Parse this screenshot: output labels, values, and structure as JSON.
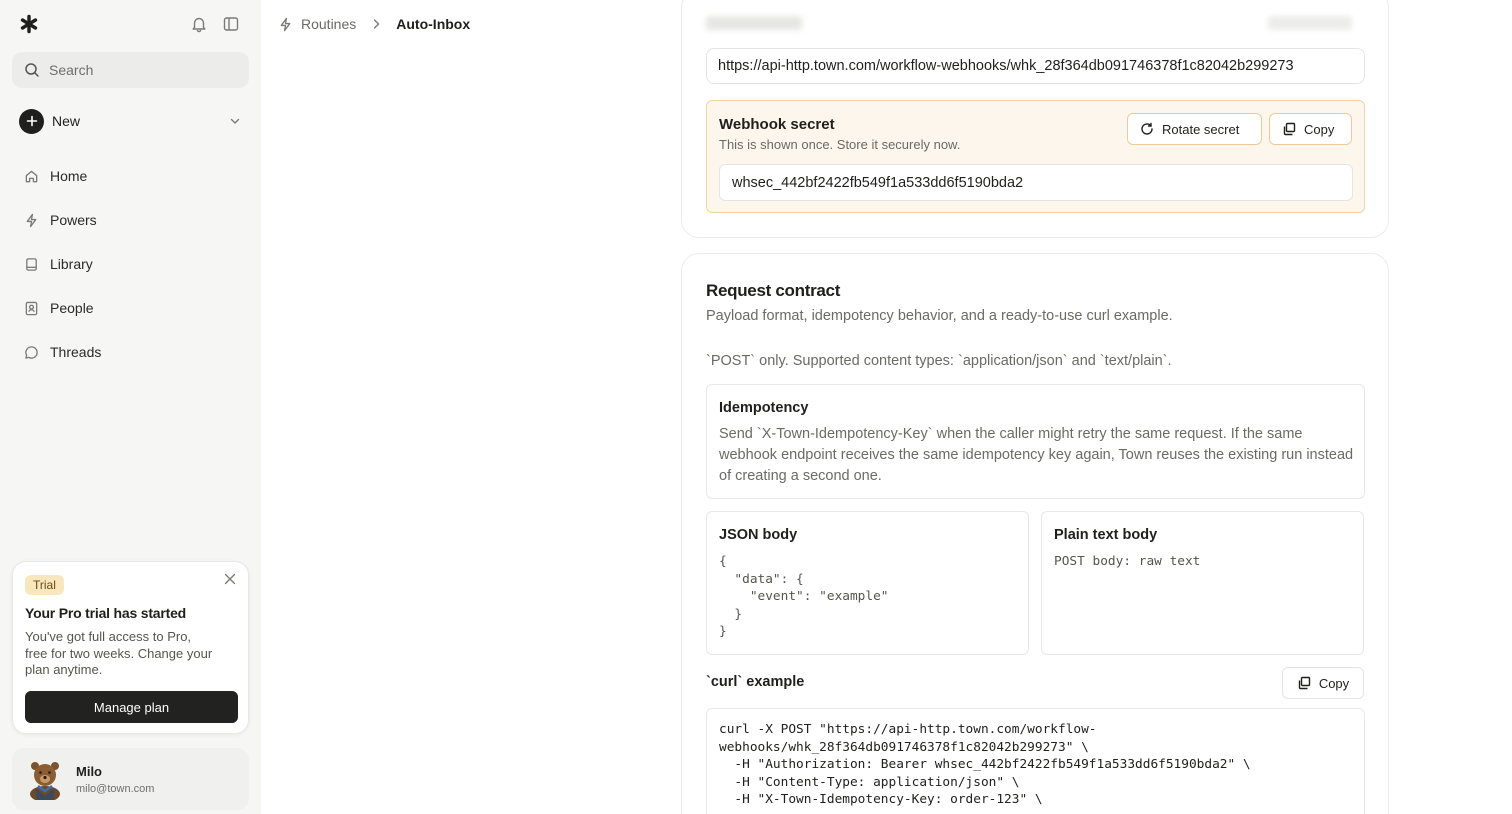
{
  "sidebar": {
    "search_placeholder": "Search",
    "new_label": "New",
    "nav": [
      {
        "label": "Home"
      },
      {
        "label": "Powers"
      },
      {
        "label": "Library"
      },
      {
        "label": "People"
      },
      {
        "label": "Threads"
      }
    ],
    "trial": {
      "badge": "Trial",
      "title": "Your Pro trial has started",
      "text": "You've got full access to Pro, free for two weeks. Change your plan anytime.",
      "button": "Manage plan"
    },
    "user": {
      "name": "Milo",
      "email": "milo@town.com"
    }
  },
  "breadcrumb": {
    "parent": "Routines",
    "current": "Auto-Inbox"
  },
  "webhook": {
    "url": "https://api-http.town.com/workflow-webhooks/whk_28f364db091746378f1c82042b299273",
    "secret_title": "Webhook secret",
    "secret_subtitle": "This is shown once. Store it securely now.",
    "rotate_label": "Rotate secret",
    "copy_label": "Copy",
    "secret_value": "whsec_442bf2422fb549f1a533dd6f5190bda2"
  },
  "request_contract": {
    "title": "Request contract",
    "subtitle": "Payload format, idempotency behavior, and a ready-to-use curl example.",
    "methods_note": "`POST` only. Supported content types: `application/json` and `text/plain`.",
    "idempotency": {
      "title": "Idempotency",
      "text": "Send `X-Town-Idempotency-Key` when the caller might retry the same request. If the same webhook endpoint receives the same idempotency key again, Town reuses the existing run instead of creating a second one."
    },
    "json_body": {
      "title": "JSON body",
      "code": "{\n  \"data\": {\n    \"event\": \"example\"\n  }\n}"
    },
    "plain_text_body": {
      "title": "Plain text body",
      "code": "POST body: raw text"
    },
    "curl": {
      "title": "`curl` example",
      "copy_label": "Copy",
      "code": "curl -X POST \"https://api-http.town.com/workflow-\nwebhooks/whk_28f364db091746378f1c82042b299273\" \\\n  -H \"Authorization: Bearer whsec_442bf2422fb549f1a533dd6f5190bda2\" \\\n  -H \"Content-Type: application/json\" \\\n  -H \"X-Town-Idempotency-Key: order-123\" \\"
    }
  },
  "colors": {
    "accent_border": "#f1d3a4",
    "secret_bg": "#fdf6ec",
    "trial_badge_bg": "#f8e6bd",
    "primary_button": "#222220"
  }
}
